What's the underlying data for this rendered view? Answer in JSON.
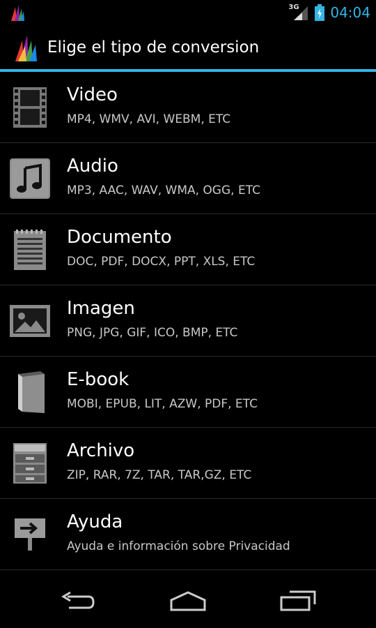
{
  "status_bar": {
    "network": "3G",
    "time": "04:04"
  },
  "action_bar": {
    "title": "Elige el tipo de conversion"
  },
  "accent_color": "#33b5e5",
  "list": [
    {
      "icon": "film-icon",
      "title": "Video",
      "subtitle": "MP4, WMV, AVI, WEBM, ETC"
    },
    {
      "icon": "music-note-icon",
      "title": "Audio",
      "subtitle": "MP3, AAC, WAV, WMA, OGG, ETC"
    },
    {
      "icon": "notepad-icon",
      "title": "Documento",
      "subtitle": "DOC, PDF, DOCX, PPT, XLS, ETC"
    },
    {
      "icon": "picture-icon",
      "title": "Imagen",
      "subtitle": "PNG, JPG, GIF, ICO, BMP, ETC"
    },
    {
      "icon": "book-icon",
      "title": "E-book",
      "subtitle": "MOBI, EPUB, LIT, AZW, PDF, ETC"
    },
    {
      "icon": "cabinet-icon",
      "title": "Archivo",
      "subtitle": "ZIP, RAR, 7Z, TAR, TAR,GZ, ETC"
    },
    {
      "icon": "signpost-icon",
      "title": "Ayuda",
      "subtitle": "Ayuda e información sobre Privacidad"
    }
  ],
  "nav_bar": {
    "buttons": [
      "back-icon",
      "home-icon",
      "recent-apps-icon"
    ]
  }
}
